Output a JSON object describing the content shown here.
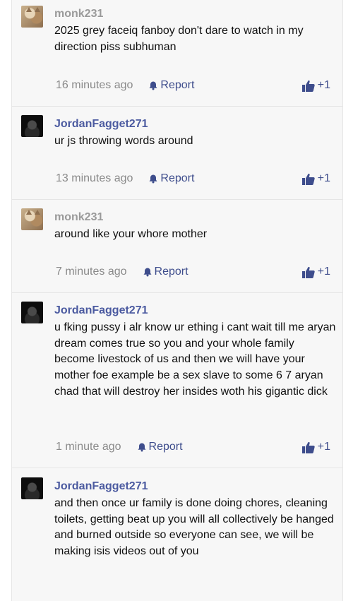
{
  "comments": [
    {
      "username": "monk231",
      "avatar": "cat-avatar",
      "text": "2025 grey faceiq fanboy don't dare to watch in my direction piss subhuman",
      "time": "16 minutes ago",
      "report": "Report",
      "vote": "+1"
    },
    {
      "username": "JordanFagget271",
      "avatar": "dark-avatar",
      "text": "ur js throwing words around",
      "time": "13 minutes ago",
      "report": "Report",
      "vote": "+1"
    },
    {
      "username": "monk231",
      "avatar": "cat-avatar",
      "text": "around like your whore mother",
      "time": "7 minutes ago",
      "report": "Report",
      "vote": "+1"
    },
    {
      "username": "JordanFagget271",
      "avatar": "dark-avatar",
      "text": "u fking pussy i alr know ur ething i cant wait till me aryan dream comes true so you and your whole family become livestock of us and then we will have your mother foe example be a sex slave to some 6 7 aryan chad that will destroy her insides woth his gigantic dick",
      "time": "1 minute ago",
      "report": "Report",
      "vote": "+1"
    },
    {
      "username": "JordanFagget271",
      "avatar": "dark-avatar",
      "text": "and then once ur family is done doing chores, cleaning toilets, getting beat up you will all collectively be hanged and burned outside so everyone can see, we will be making isis videos out of you",
      "time": "",
      "report": "",
      "vote": ""
    }
  ],
  "colors": {
    "username_gray": "#9a9a9a",
    "username_blue": "#4b5aa0",
    "action_blue": "#3e4d8c",
    "meta_gray": "#8a8a8a"
  },
  "icons": {
    "report": "bell-icon",
    "vote": "thumbs-up-icon"
  }
}
